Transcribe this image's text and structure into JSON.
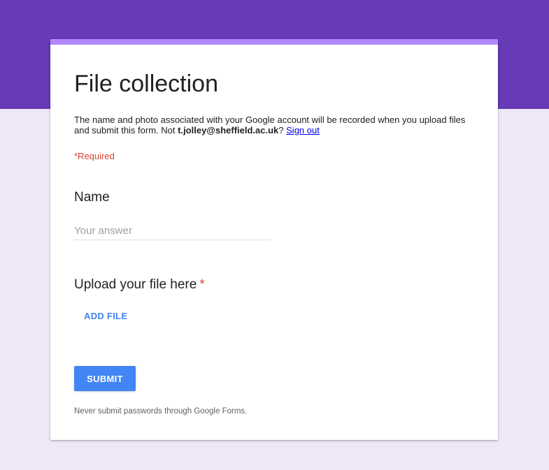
{
  "colors": {
    "header_band": "#673ab7",
    "page_background": "#ede7f6",
    "card_accent": "#b388ff",
    "primary_button": "#4285f4",
    "required": "#db4437"
  },
  "form": {
    "title": "File collection",
    "description": {
      "prefix": "The name and photo associated with your Google account will be recorded when you upload files and submit this form. Not ",
      "account_email": "t.jolley@sheffield.ac.uk",
      "question_mark": "? ",
      "sign_out_link": "Sign out"
    },
    "required_note": "*Required"
  },
  "questions": [
    {
      "title": "Name",
      "required": false,
      "input_placeholder": "Your answer",
      "input_value": ""
    },
    {
      "title": "Upload your file here",
      "required": true,
      "required_marker": "*",
      "button_label": "ADD FILE"
    }
  ],
  "actions": {
    "submit_label": "SUBMIT"
  },
  "footer": {
    "note": "Never submit passwords through Google Forms."
  }
}
